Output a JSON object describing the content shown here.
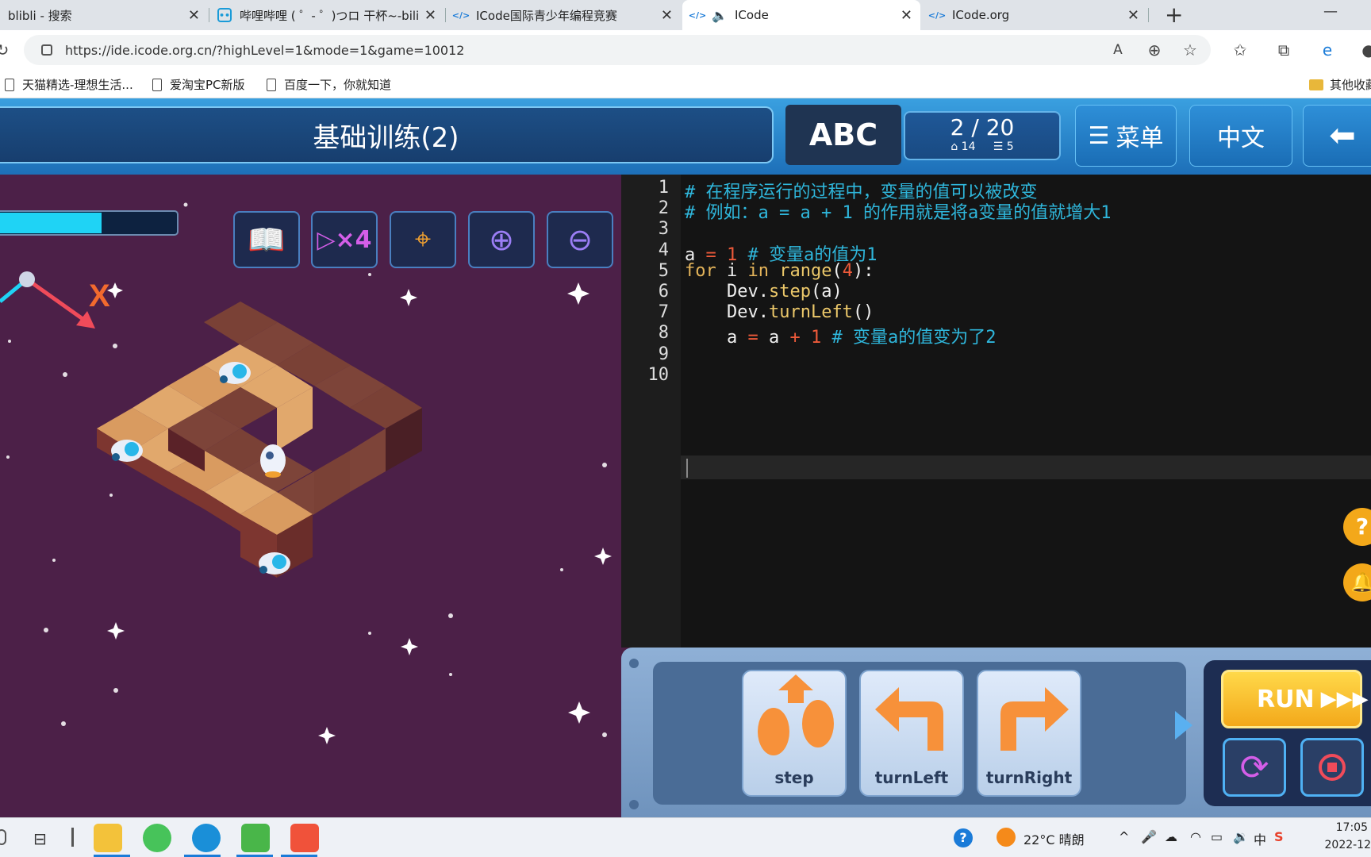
{
  "browser": {
    "tabs": [
      {
        "title": "blibli - 搜索",
        "active": false
      },
      {
        "title": "哔哩哔哩 ( ゜- ゜)つロ 干杯~-bilibili",
        "active": false
      },
      {
        "title": "ICode国际青少年编程竞赛",
        "active": false
      },
      {
        "title": "ICode",
        "active": true
      },
      {
        "title": "ICode.org",
        "active": false
      }
    ],
    "new_tab": "+",
    "minimize": "—",
    "url": "https://ide.icode.org.cn/?highLevel=1&mode=1&game=10012",
    "bookmarks": [
      "天猫精选-理想生活...",
      "爱淘宝PC新版",
      "百度一下，你就知道"
    ],
    "other_favorites": "其他收藏"
  },
  "game": {
    "title": "基础训练(2)",
    "abc_label": "ABC",
    "progress": "2 / 20",
    "stat_a": "14",
    "stat_b": "5",
    "menu_label": "菜单",
    "language_label": "中文",
    "health_fraction": 0.6,
    "code_lines": [
      "# 在程序运行的过程中，变量的值可以被改变",
      "# 例如：a = a + 1 的作用就是将a变量的值就增大1",
      "",
      "a = 1 # 变量a的值为1",
      "for i in range(4):",
      "    Dev.step(a)",
      "    Dev.turnLeft()",
      "    a = a + 1 # 变量a的值变为了2",
      "",
      ""
    ],
    "line_numbers": [
      "1",
      "2",
      "3",
      "4",
      "5",
      "6",
      "7",
      "8",
      "9",
      "10"
    ],
    "blocks": [
      "step",
      "turnLeft",
      "turnRight"
    ],
    "run_label": "RUN"
  },
  "taskbar": {
    "weather": "22°C  晴朗",
    "time": "17:05",
    "date": "2022-12",
    "ime": "中"
  },
  "colors": {
    "scene_bg": "#4c2048",
    "header_blue": "#1d6fb8",
    "comment": "#2fb7dc",
    "keyword": "#e4b45a"
  }
}
